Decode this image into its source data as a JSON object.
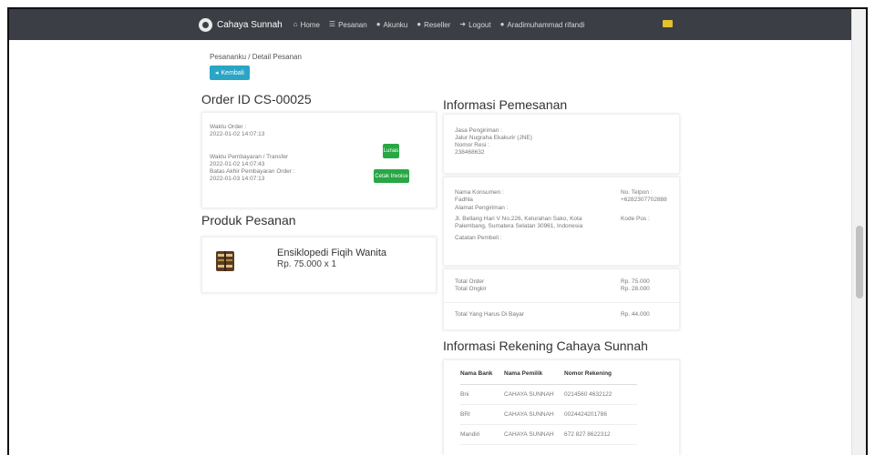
{
  "navbar": {
    "brand": "Cahaya Sunnah",
    "items": [
      {
        "icon": "home-icon",
        "glyph": "⌂",
        "label": "Home"
      },
      {
        "icon": "list-icon",
        "glyph": "☰",
        "label": "Pesanan"
      },
      {
        "icon": "user-icon",
        "glyph": "●",
        "label": "Akunku"
      },
      {
        "icon": "users-icon",
        "glyph": "●",
        "label": "Reseller"
      },
      {
        "icon": "logout-icon",
        "glyph": "➜",
        "label": "Logout"
      },
      {
        "icon": "user-icon",
        "glyph": "●",
        "label": "Aradimuhammad rifandi"
      }
    ],
    "flag_color": "#e4c22d",
    "bg_color": "#3b3f45"
  },
  "breadcrumb": "Pesananku / Detail Pesanan",
  "back_button": "Kembali",
  "order": {
    "title": "Order ID CS-00025",
    "waktu_order_label": "Waktu Order :",
    "waktu_order_value": "2022-01-02 14:07:13",
    "waktu_bayar_label": "Waktu Pembayaran / Transfer",
    "waktu_bayar_value": "2022-01-02 14:07:43",
    "batas_label": "Batas Akhir Pembayaran Order :",
    "batas_value": "2022-01-03 14:07:13",
    "status_button": "Lunas",
    "cetak_button": "Cetak Invoice"
  },
  "produk": {
    "title": "Produk Pesanan",
    "items": [
      {
        "name": "Ensiklopedi Fiqih Wanita",
        "price": "Rp. 75.000 x 1"
      }
    ]
  },
  "info": {
    "title": "Informasi Pemesanan",
    "jasa_label": "Jasa Pengiriman :",
    "jasa_value": "Jalur Nugraha Ekakurir (JNE)",
    "resi_label": "Nomor Resi :",
    "resi_value": "238468632",
    "nama_label": "Nama Konsumen :",
    "nama_value": "Fadhla",
    "hp_label": "No. Telpon :",
    "hp_value": "+6282307702888",
    "alamat_label": "Alamat Pengiriman :",
    "alamat_value": "Jl. Bellang Hari V No.226, Kelurahan Sako, Kota Palembang, Sumatera Selatan 30961, Indonesia",
    "kode_label": "Kode Pos :",
    "catatan_label": "Catatan Pembeli :",
    "total_order_label": "Total Order",
    "total_order_value": "Rp. 75.000",
    "total_ongkir_label": "Total Ongkir",
    "total_ongkir_value": "Rp. 28.000",
    "total_bayar_label": "Total Yang Harus Di Bayar",
    "total_bayar_value": "Rp. 44.000"
  },
  "rekening": {
    "title": "Informasi Rekening Cahaya Sunnah",
    "headers": [
      "Nama Bank",
      "Nama Pemilik",
      "Nomor Rekening"
    ],
    "rows": [
      [
        "Bni",
        "CAHAYA SUNNAH",
        "0214560 4632122"
      ],
      [
        "BRI",
        "CAHAYA SUNNAH",
        "0024424201786"
      ],
      [
        "Mandiri",
        "CAHAYA SUNNAH",
        "672 827 8622312"
      ]
    ]
  },
  "colors": {
    "accent_cyan": "#2aa5c5",
    "success_green": "#28a745"
  }
}
